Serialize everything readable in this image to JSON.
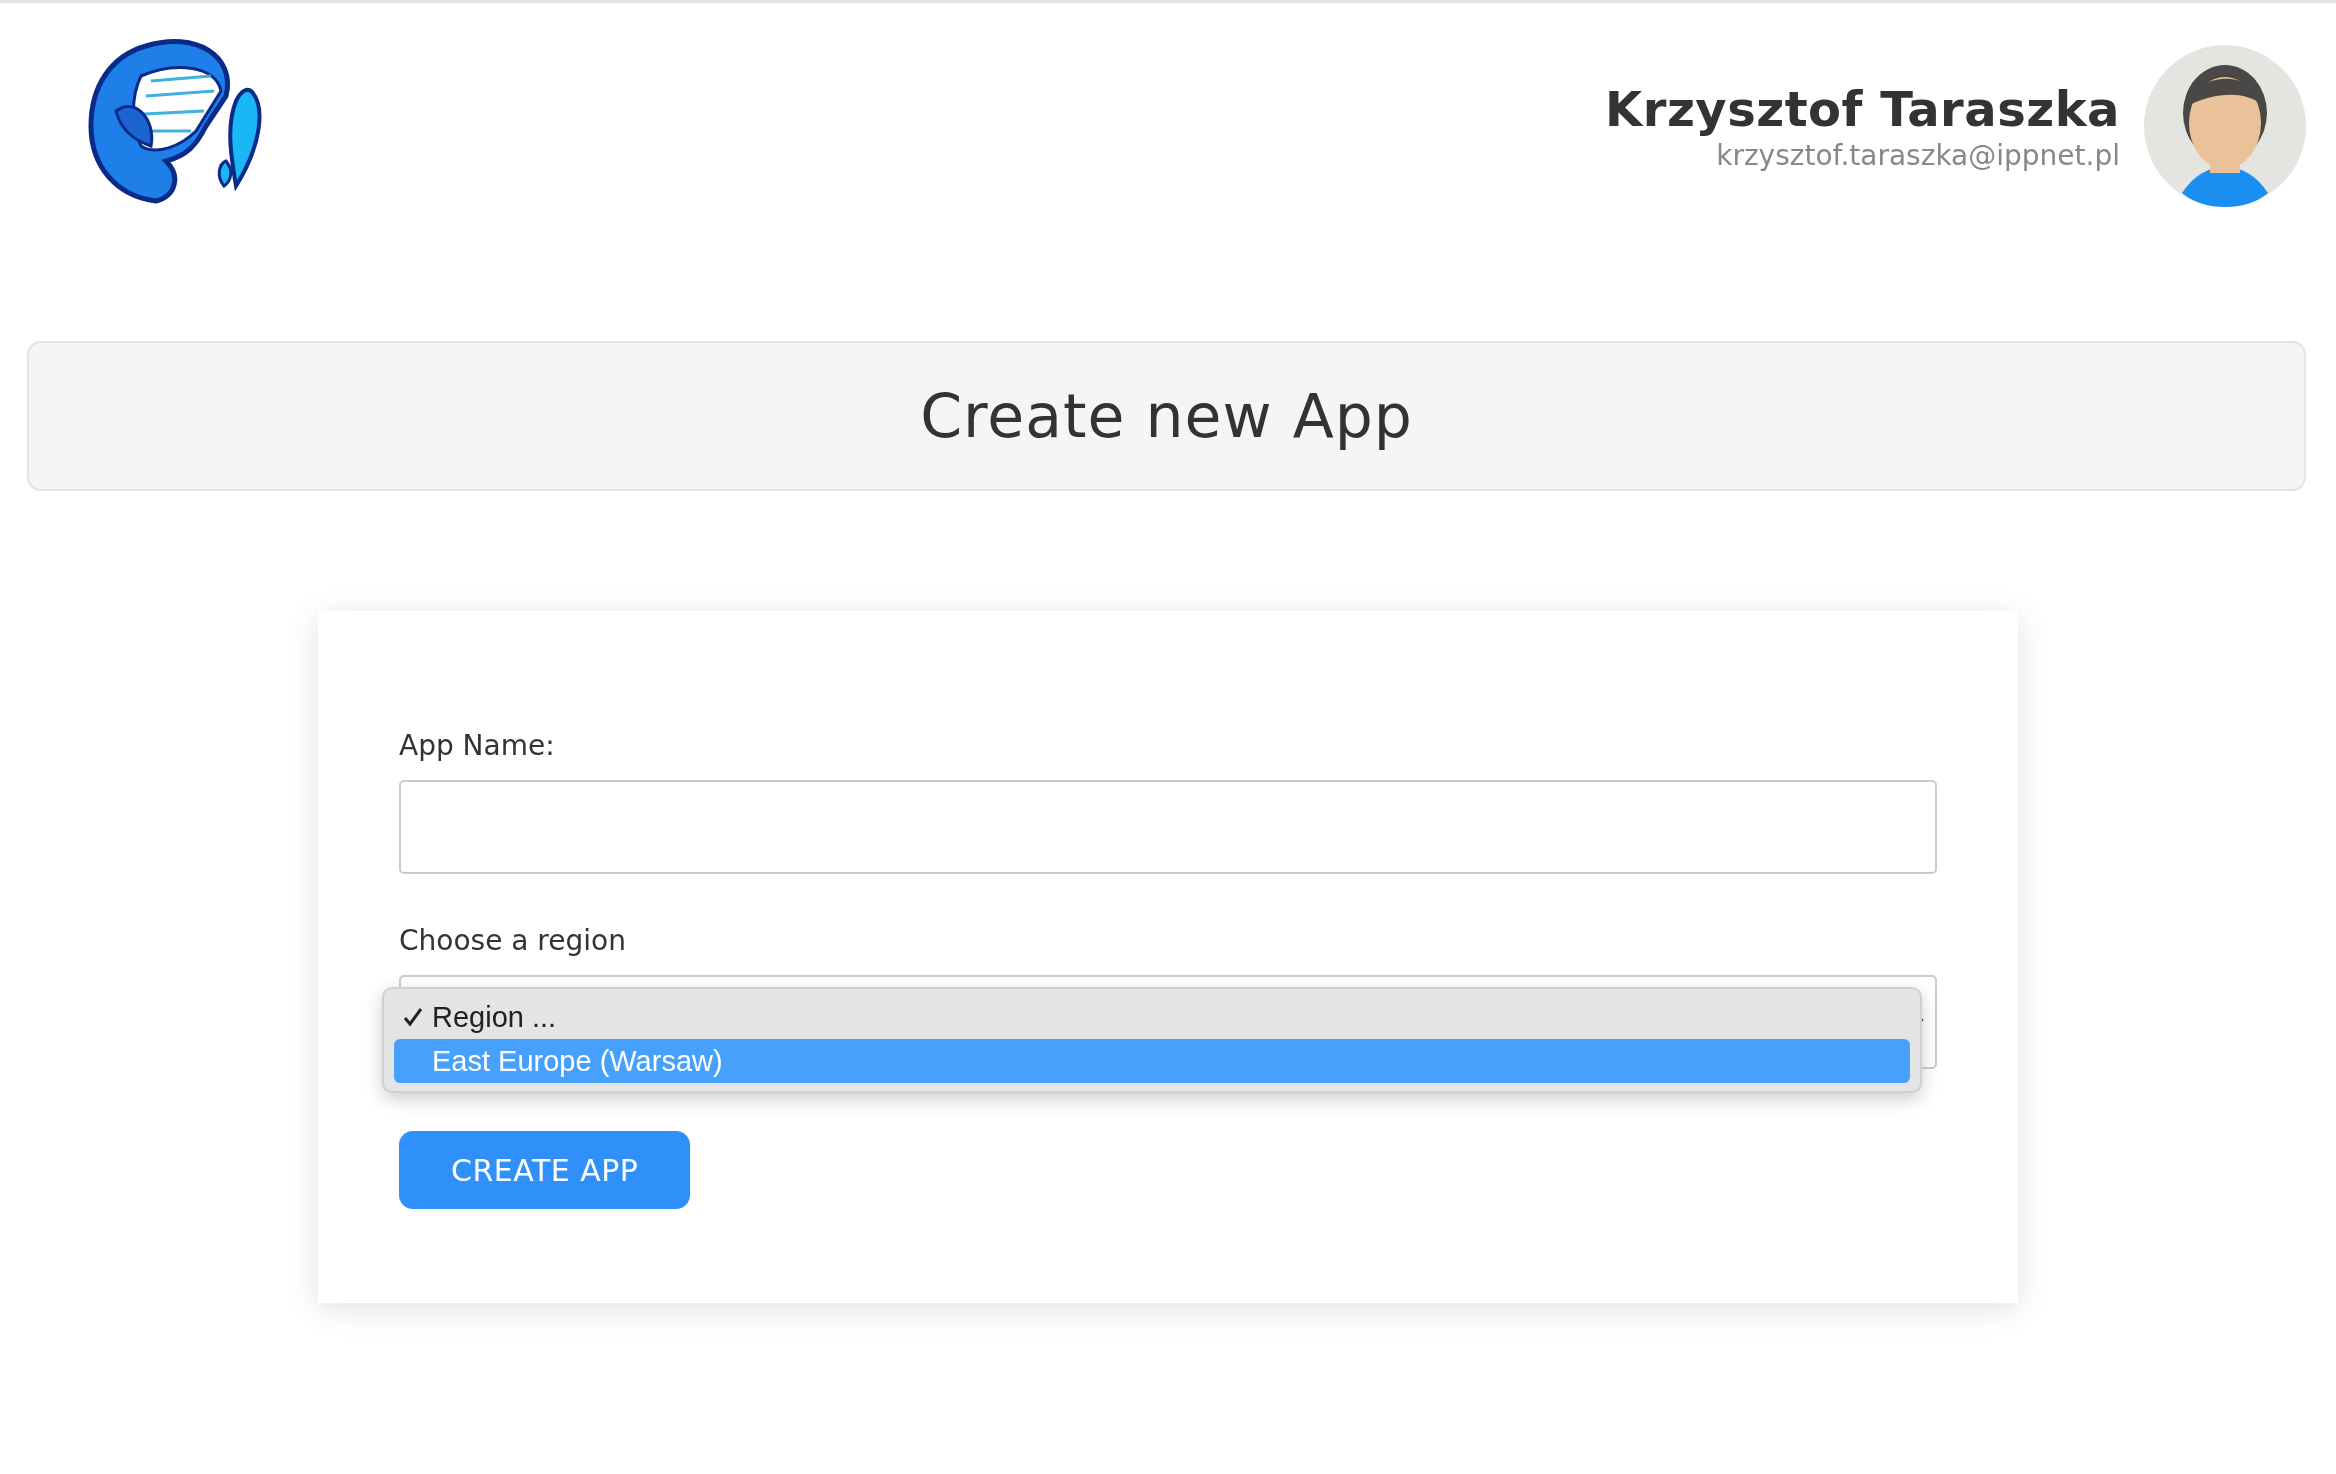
{
  "user": {
    "name": "Krzysztof Taraszka",
    "email": "krzysztof.taraszka@ippnet.pl"
  },
  "banner": {
    "title": "Create new App"
  },
  "form": {
    "app_name": {
      "label": "App Name:"
    },
    "region": {
      "label": "Choose a region",
      "expanded": true,
      "options": [
        {
          "label": "Region ...",
          "selected": true,
          "highlighted": false
        },
        {
          "label": "East Europe (Warsaw)",
          "selected": false,
          "highlighted": true
        }
      ]
    },
    "submit": "CREATE APP"
  }
}
